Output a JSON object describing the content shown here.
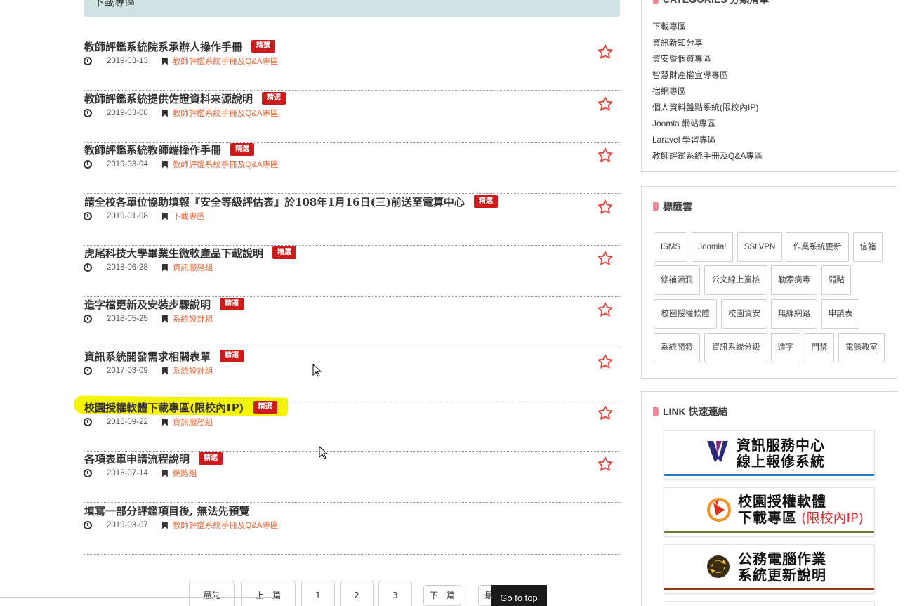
{
  "header": {
    "title": "下載專區"
  },
  "articles": [
    {
      "title": "教師評鑑系統院系承辦人操作手冊",
      "badge": "精選",
      "date": "2019-03-13",
      "category": "教師評鑑系統手冊及Q&A專區"
    },
    {
      "title": "教師評鑑系統提供佐證資料來源說明",
      "badge": "精選",
      "date": "2019-03-08",
      "category": "教師評鑑系統手冊及Q&A專區"
    },
    {
      "title": "教師評鑑系統教師端操作手冊",
      "badge": "精選",
      "date": "2019-03-04",
      "category": "教師評鑑系統手冊及Q&A專區"
    },
    {
      "title": "請全校各單位協助填報『安全等級評估表』於108年1月16日(三)前送至電算中心",
      "badge": "精選",
      "date": "2019-01-08",
      "category": "下載專區"
    },
    {
      "title": "虎尾科技大學畢業生微軟產品下載說明",
      "badge": "精選",
      "date": "2018-06-28",
      "category": "資訊服務組"
    },
    {
      "title": "造字檔更新及安裝步驟說明",
      "badge": "精選",
      "date": "2018-05-25",
      "category": "系統設計組"
    },
    {
      "title": "資訊系統開發需求相關表單",
      "badge": "精選",
      "date": "2017-03-09",
      "category": "系統設計組"
    },
    {
      "title": "校園授權軟體下載專區(限校內IP)",
      "badge": "精選",
      "date": "2015-09-22",
      "category": "資訊服務組"
    },
    {
      "title": "各項表單申請流程說明",
      "badge": "精選",
      "date": "2015-07-14",
      "category": "網路組"
    },
    {
      "title": "填寫一部分評鑑項目後, 無法先預覽",
      "badge": "",
      "date": "2019-03-07",
      "category": "教師評鑑系統手冊及Q&A專區"
    }
  ],
  "pagination": {
    "first": "最先",
    "prev": "上一篇",
    "pages": [
      "1",
      "2",
      "3"
    ],
    "next": "下一篇",
    "last": "最"
  },
  "goto_top": "Go to top",
  "sidebar": {
    "categories": {
      "title": "CATEGORIES 分類清單",
      "items": [
        "下載專區",
        "資訊新知分享",
        "資安暨個資專區",
        "智慧財產權宣導專區",
        "宿網專區",
        "個人資料盤點系統(限校內IP)",
        " Joomla 網站專區",
        " Laravel 學習專區",
        " 教師評鑑系統手冊及Q&A專區"
      ]
    },
    "tags": {
      "title": "標籤雲",
      "items": [
        "ISMS",
        "Joomla!",
        "SSLVPN",
        "作業系統更新",
        "信箱",
        "修補漏洞",
        "公文線上簽核",
        "勒索病毒",
        "弱點",
        "校園授權軟體",
        "校園資安",
        "無線網路",
        "申請表",
        "系統開發",
        "資訊系統分級",
        "造字",
        "門禁",
        "電腦教室"
      ]
    },
    "links": {
      "title": "LINK 快速連結",
      "banners": [
        {
          "line1": "資訊服務中心",
          "line2": "線上報修系統",
          "line2_extra": "",
          "bar_color": "#2e77bb",
          "icon": "v-logo-icon"
        },
        {
          "line1": "校園授權軟體",
          "line2": "下載專區",
          "line2_extra": " (限校內IP)",
          "bar_color": "#6b7a2e",
          "icon": "play-logo-icon"
        },
        {
          "line1": "公務電腦作業",
          "line2": "系統更新說明",
          "line2_extra": "",
          "bar_color": "#8b3a1a",
          "icon": "update-logo-icon"
        }
      ]
    }
  },
  "colors": {
    "badge": "#cc1b1b",
    "category_link": "#e2683c",
    "highlight": "#f6f300",
    "header_band": "#cfe2e2",
    "star": "#e0453a"
  }
}
